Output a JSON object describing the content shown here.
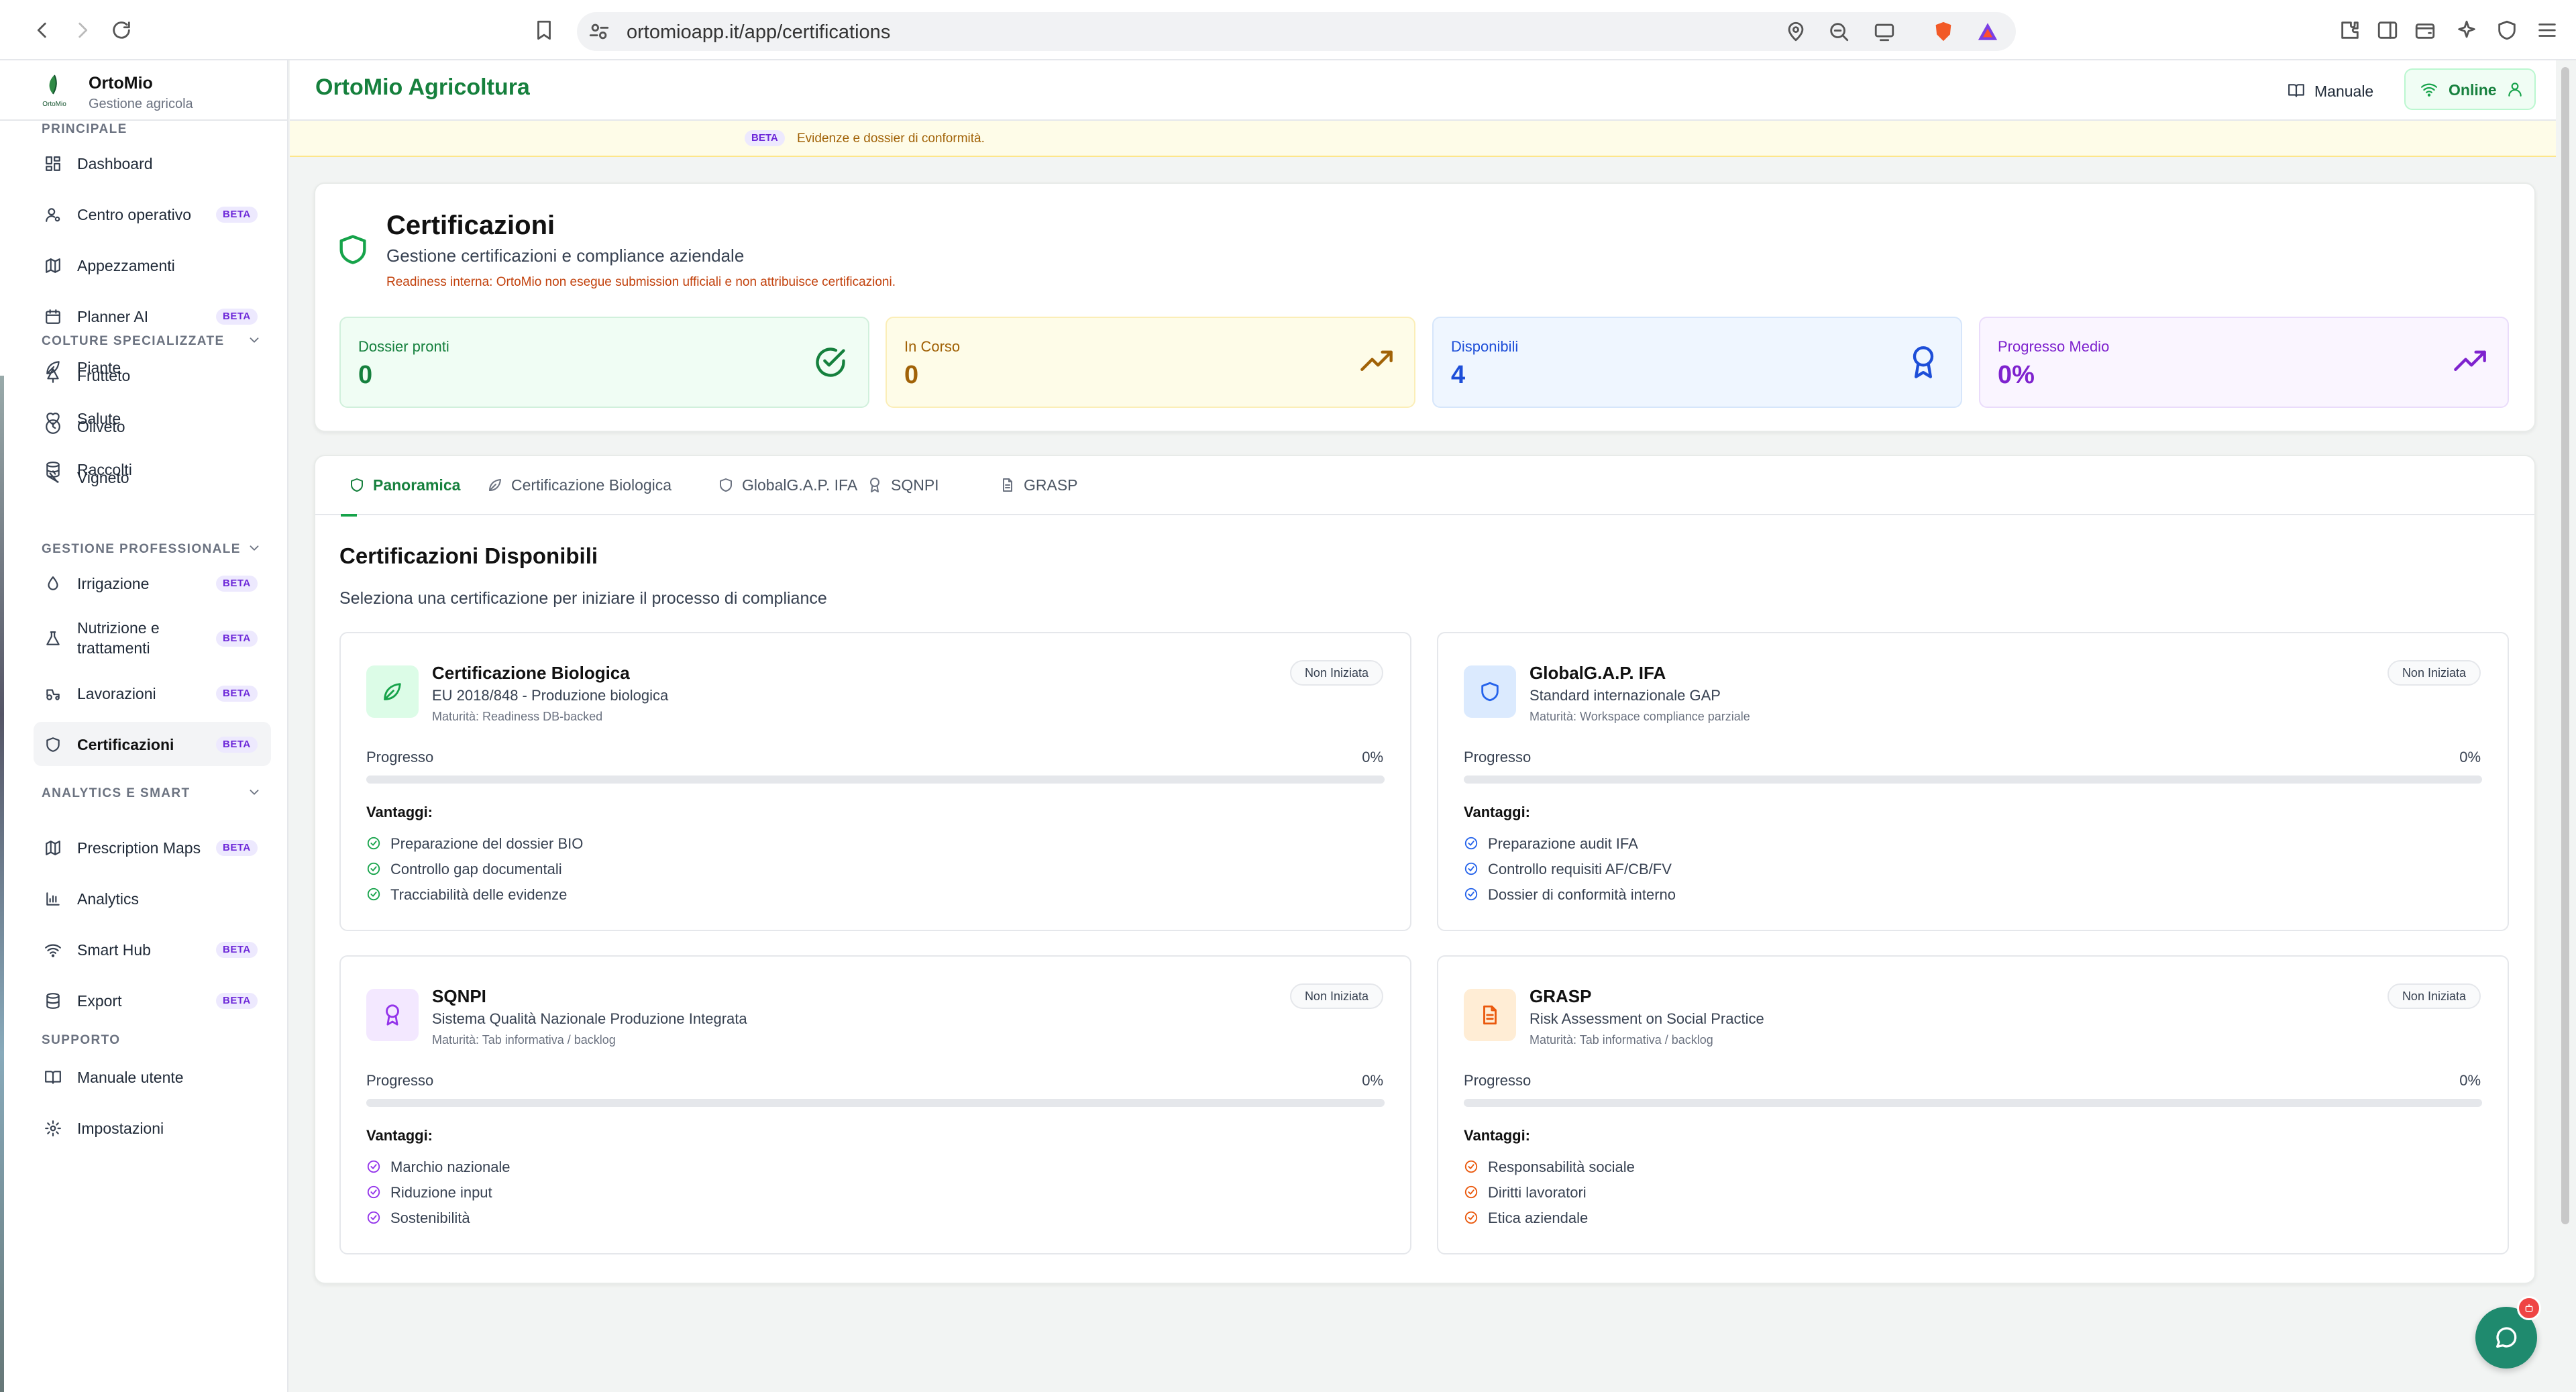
{
  "browser": {
    "url": "ortomioapp.it/app/certifications"
  },
  "sidebar": {
    "brand": {
      "name": "OrtoMio",
      "subtitle": "Gestione agricola"
    },
    "sections": [
      {
        "title": "PRINCIPALE",
        "collapsible": false,
        "items": [
          {
            "label": "Dashboard",
            "icon": "grid-icon",
            "beta": ""
          },
          {
            "label": "Centro operativo",
            "icon": "user-cog-icon",
            "beta": "BETA"
          },
          {
            "label": "Appezzamenti",
            "icon": "map-icon",
            "beta": ""
          },
          {
            "label": "Planner AI",
            "icon": "calendar-icon",
            "beta": "BETA"
          },
          {
            "label": "Piante",
            "icon": "leaf-icon",
            "beta": ""
          },
          {
            "label": "Salute",
            "icon": "heart-icon",
            "beta": ""
          },
          {
            "label": "Raccolti",
            "icon": "database-icon",
            "beta": ""
          }
        ]
      },
      {
        "title": "COLTURE SPECIALIZZATE",
        "collapsible": true,
        "items": [
          {
            "label": "Frutteto",
            "icon": "tree-icon",
            "beta": ""
          },
          {
            "label": "Oliveto",
            "icon": "olive-icon",
            "beta": ""
          },
          {
            "label": "Vigneto",
            "icon": "grape-icon",
            "beta": ""
          }
        ]
      },
      {
        "title": "GESTIONE PROFESSIONALE",
        "collapsible": true,
        "items": [
          {
            "label": "Irrigazione",
            "icon": "droplet-icon",
            "beta": "BETA"
          },
          {
            "label": "Nutrizione e trattamenti",
            "icon": "flask-icon",
            "beta": "BETA"
          },
          {
            "label": "Lavorazioni",
            "icon": "tractor-icon",
            "beta": "BETA"
          },
          {
            "label": "Certificazioni",
            "icon": "shield-icon",
            "beta": "BETA",
            "active": true
          }
        ]
      },
      {
        "title": "ANALYTICS E SMART",
        "collapsible": true,
        "items": [
          {
            "label": "Prescription Maps",
            "icon": "map-icon",
            "beta": "BETA"
          },
          {
            "label": "Analytics",
            "icon": "bar-chart-icon",
            "beta": ""
          },
          {
            "label": "Smart Hub",
            "icon": "wifi-icon",
            "beta": "BETA"
          },
          {
            "label": "Export",
            "icon": "database-icon",
            "beta": "BETA"
          }
        ]
      },
      {
        "title": "SUPPORTO",
        "collapsible": false,
        "items": [
          {
            "label": "Manuale utente",
            "icon": "book-icon",
            "beta": ""
          },
          {
            "label": "Impostazioni",
            "icon": "gear-icon",
            "beta": ""
          }
        ]
      }
    ]
  },
  "topbar": {
    "title": "OrtoMio Agricoltura",
    "manual_label": "Manuale",
    "online_label": "Online"
  },
  "banner": {
    "badge": "BETA",
    "text": "Evidenze e dossier di conformità."
  },
  "header": {
    "title": "Certificazioni",
    "subtitle": "Gestione certificazioni e compliance aziendale",
    "note": "Readiness interna: OrtoMio non esegue submission ufficiali e non attribuisce certificazioni."
  },
  "stats": [
    {
      "label": "Dossier pronti",
      "value": "0",
      "icon": "check-circle-icon"
    },
    {
      "label": "In Corso",
      "value": "0",
      "icon": "trending-up-icon"
    },
    {
      "label": "Disponibili",
      "value": "4",
      "icon": "award-icon"
    },
    {
      "label": "Progresso Medio",
      "value": "0%",
      "icon": "trending-up-icon"
    }
  ],
  "tabs": [
    {
      "label": "Panoramica",
      "icon": "shield-icon",
      "active": true
    },
    {
      "label": "Certificazione Biologica",
      "icon": "leaf-icon"
    },
    {
      "label": "GlobalG.A.P. IFA",
      "icon": "shield-icon"
    },
    {
      "label": "SQNPI",
      "icon": "award-icon"
    },
    {
      "label": "GRASP",
      "icon": "file-icon"
    }
  ],
  "section": {
    "title": "Certificazioni Disponibili",
    "subtitle": "Seleziona una certificazione per iniziare il processo di compliance"
  },
  "certifications": [
    {
      "name": "Certificazione Biologica",
      "description": "EU 2018/848 - Produzione biologica",
      "maturity": "Maturità: Readiness DB-backed",
      "status": "Non Iniziata",
      "progress_label": "Progresso",
      "progress_value": "0%",
      "progress": 0,
      "advantages_title": "Vantaggi:",
      "advantages": [
        "Preparazione del dossier BIO",
        "Controllo gap documentali",
        "Tracciabilità delle evidenze"
      ],
      "icon": "leaf-icon",
      "accent": "#16a34a",
      "accent_bg": "#dcfce7"
    },
    {
      "name": "GlobalG.A.P. IFA",
      "description": "Standard internazionale GAP",
      "maturity": "Maturità: Workspace compliance parziale",
      "status": "Non Iniziata",
      "progress_label": "Progresso",
      "progress_value": "0%",
      "progress": 0,
      "advantages_title": "Vantaggi:",
      "advantages": [
        "Preparazione audit IFA",
        "Controllo requisiti AF/CB/FV",
        "Dossier di conformità interno"
      ],
      "icon": "shield-icon",
      "accent": "#2563eb",
      "accent_bg": "#dbeafe"
    },
    {
      "name": "SQNPI",
      "description": "Sistema Qualità Nazionale Produzione Integrata",
      "maturity": "Maturità: Tab informativa / backlog",
      "status": "Non Iniziata",
      "progress_label": "Progresso",
      "progress_value": "0%",
      "progress": 0,
      "advantages_title": "Vantaggi:",
      "advantages": [
        "Marchio nazionale",
        "Riduzione input",
        "Sostenibilità"
      ],
      "icon": "award-icon",
      "accent": "#9333ea",
      "accent_bg": "#f3e8ff"
    },
    {
      "name": "GRASP",
      "description": "Risk Assessment on Social Practice",
      "maturity": "Maturità: Tab informativa / backlog",
      "status": "Non Iniziata",
      "progress_label": "Progresso",
      "progress_value": "0%",
      "progress": 0,
      "advantages_title": "Vantaggi:",
      "advantages": [
        "Responsabilità sociale",
        "Diritti lavoratori",
        "Etica aziendale"
      ],
      "icon": "file-icon",
      "accent": "#ea580c",
      "accent_bg": "#ffedd5"
    }
  ]
}
